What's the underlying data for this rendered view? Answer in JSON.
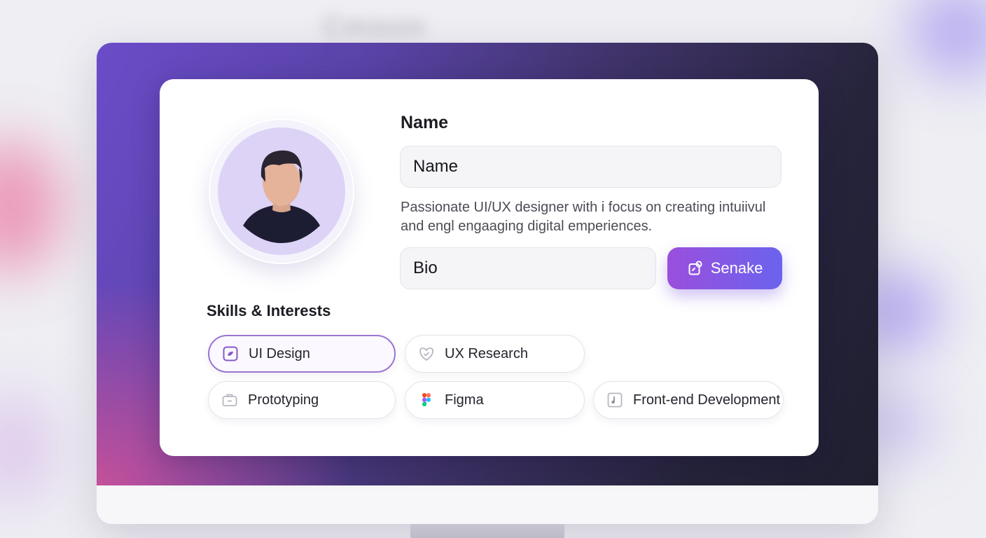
{
  "background": {
    "blurred_heading": "Cmson"
  },
  "profile": {
    "name_heading": "Name",
    "name_field_value": "Name",
    "bio_text": "Passionate UI/UX designer with i focus on creating intuiivul and engl engaaging digital emperiences.",
    "bio_field_value": "Bio",
    "primary_button_label": "Senake"
  },
  "skills": {
    "title": "Skills & Interests",
    "items": [
      {
        "label": "UI Design",
        "icon": "ui-design-icon",
        "selected": true
      },
      {
        "label": "UX Research",
        "icon": "heart-shield-icon",
        "selected": false
      },
      {
        "label": "Prototyping",
        "icon": "briefcase-icon",
        "selected": false
      },
      {
        "label": "Figma",
        "icon": "figma-icon",
        "selected": false
      },
      {
        "label": "Front-end Development",
        "icon": "code-file-icon",
        "selected": false
      }
    ]
  },
  "colors": {
    "accent_start": "#9a4fdc",
    "accent_end": "#6b63ee",
    "selected_border": "#9b74d2",
    "avatar_bg": "#dcd3f6"
  }
}
